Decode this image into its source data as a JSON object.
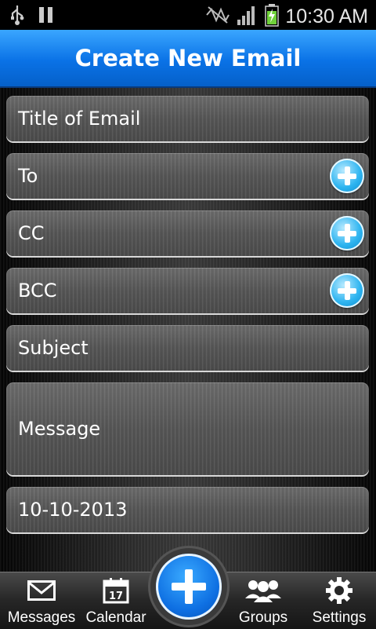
{
  "status_bar": {
    "time": "10:30 AM",
    "icons": [
      "usb-icon",
      "pause-icon",
      "no-signal-icon",
      "signal-bars-icon",
      "battery-charging-icon"
    ]
  },
  "header": {
    "title": "Create New Email"
  },
  "form": {
    "title_field": {
      "value": "Title of Email"
    },
    "to_field": {
      "value": "To",
      "action_icon": "plus-icon"
    },
    "cc_field": {
      "value": "CC",
      "action_icon": "plus-icon"
    },
    "bcc_field": {
      "value": "BCC",
      "action_icon": "plus-icon"
    },
    "subject_field": {
      "value": "Subject"
    },
    "message_field": {
      "value": "Message"
    },
    "date_field": {
      "value": "10-10-2013"
    }
  },
  "bottom_nav": {
    "messages": {
      "label": "Messages",
      "icon": "envelope-icon"
    },
    "calendar": {
      "label": "Calendar",
      "icon": "calendar-icon",
      "day": "17"
    },
    "create": {
      "icon": "plus-icon"
    },
    "groups": {
      "label": "Groups",
      "icon": "group-icon"
    },
    "settings": {
      "label": "Settings",
      "icon": "gear-icon"
    }
  },
  "colors": {
    "accent": "#0a72e6",
    "plus_button": "#2db4f0"
  }
}
